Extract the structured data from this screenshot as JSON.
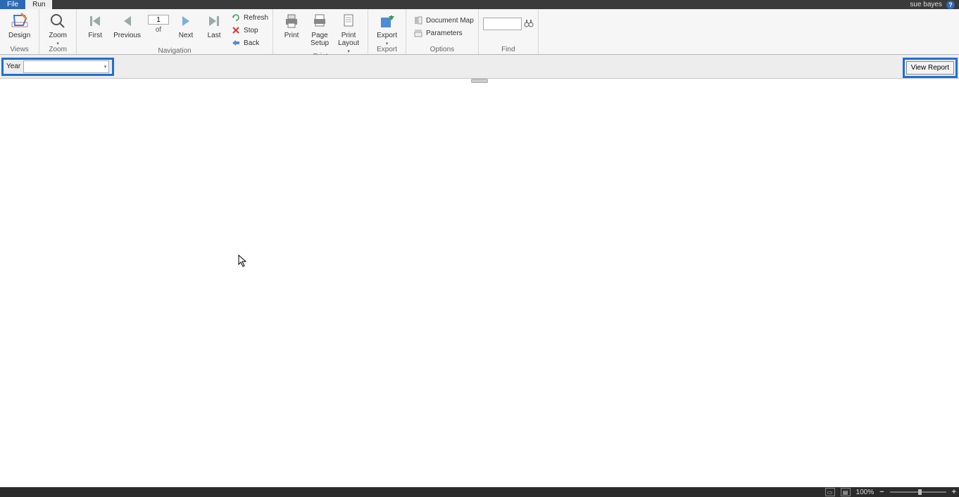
{
  "titlebar": {
    "file_tab": "File",
    "run_tab": "Run",
    "user": "sue bayes",
    "help": "?"
  },
  "ribbon": {
    "views": {
      "design": "Design",
      "group_label": "Views"
    },
    "zoom": {
      "zoom": "Zoom",
      "group_label": "Zoom"
    },
    "navigation": {
      "first": "First",
      "previous": "Previous",
      "page_value": "1",
      "of": "of",
      "next": "Next",
      "last": "Last",
      "refresh": "Refresh",
      "stop": "Stop",
      "back": "Back",
      "group_label": "Navigation"
    },
    "print": {
      "print": "Print",
      "page_setup_l1": "Page",
      "page_setup_l2": "Setup",
      "print_layout_l1": "Print",
      "print_layout_l2": "Layout",
      "group_label": "Print"
    },
    "export": {
      "export": "Export",
      "group_label": "Export"
    },
    "options": {
      "document_map": "Document Map",
      "parameters": "Parameters",
      "group_label": "Options"
    },
    "find": {
      "group_label": "Find"
    }
  },
  "parambar": {
    "year_label": "Year",
    "view_report": "View Report"
  },
  "statusbar": {
    "zoom_level": "100%"
  }
}
